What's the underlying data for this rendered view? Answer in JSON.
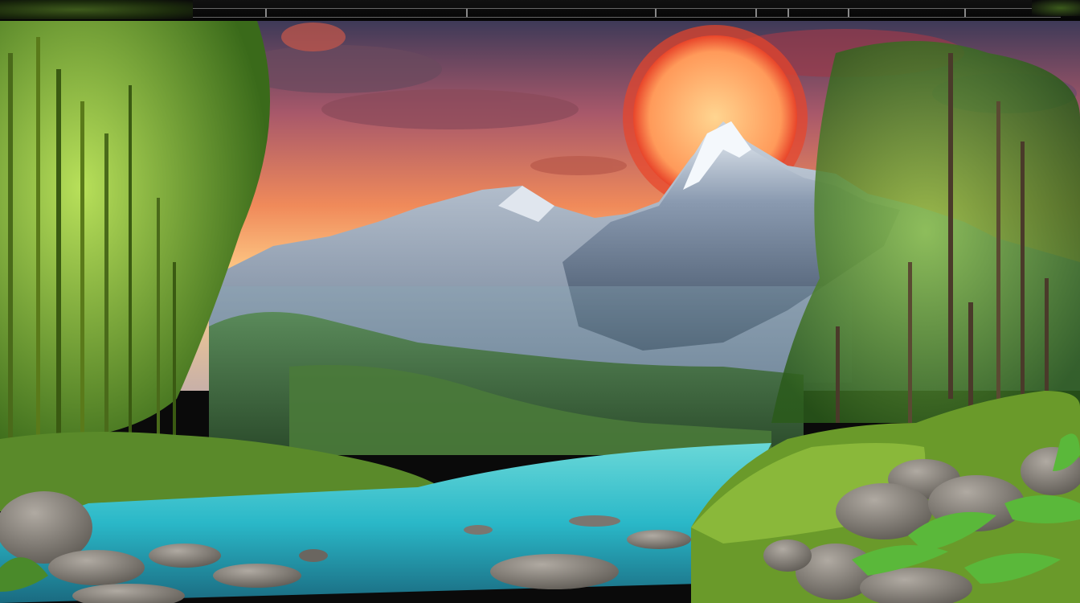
{
  "scene": {
    "elements": [
      "sky",
      "sun",
      "clouds",
      "mountains",
      "forest-hills",
      "bamboo-left",
      "trees-right",
      "river",
      "rocks",
      "grass-banks",
      "plants"
    ]
  },
  "colors": {
    "sky_top": "#4a3a5a",
    "sky_mid": "#e86a4a",
    "sky_glow": "#ffd27a",
    "sun": "#ffb56a",
    "sun_ring": "#e83a2a",
    "mountain_snow": "#e8eef5",
    "mountain_rock": "#5a6a80",
    "forest": "#4a7a3a",
    "bamboo": "#8ab83a",
    "river": "#3ac2c8",
    "rock": "#8a8680",
    "grass": "#7aa83a"
  }
}
